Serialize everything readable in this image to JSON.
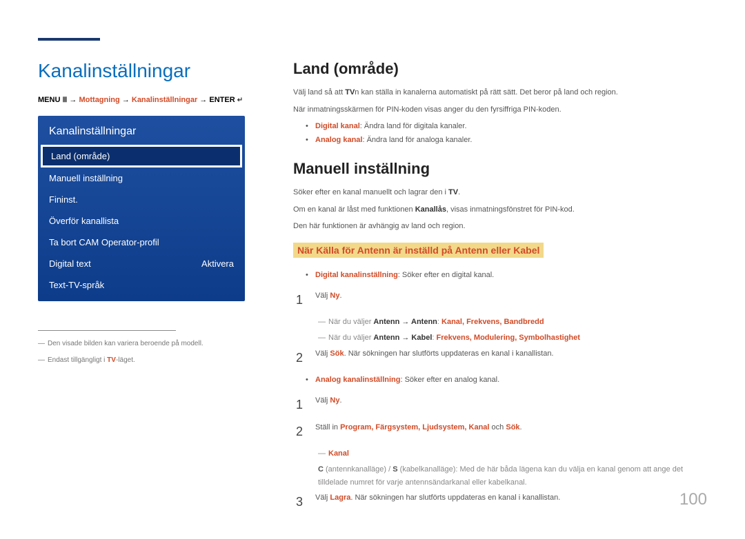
{
  "title": "Kanalinställningar",
  "breadcrumb": {
    "menu": "MENU",
    "arrow": "→",
    "p1": "Mottagning",
    "p2": "Kanalinställningar",
    "enter": "ENTER"
  },
  "menu": {
    "title": "Kanalinställningar",
    "items": [
      {
        "label": "Land (område)",
        "value": "",
        "selected": true
      },
      {
        "label": "Manuell inställning",
        "value": ""
      },
      {
        "label": "Fininst.",
        "value": ""
      },
      {
        "label": "Överför kanallista",
        "value": ""
      },
      {
        "label": "Ta bort CAM Operator-profil",
        "value": ""
      },
      {
        "label": "Digital text",
        "value": "Aktivera"
      },
      {
        "label": "Text-TV-språk",
        "value": ""
      }
    ]
  },
  "footnotes": [
    {
      "pre": "―",
      "text": "Den visade bilden kan variera beroende på modell."
    },
    {
      "pre": "―",
      "text_before": "Endast tillgängligt i ",
      "red": "TV",
      "text_after": "-läget."
    }
  ],
  "land": {
    "head": "Land (område)",
    "p1a": "Välj land så att ",
    "p1b": "TV",
    "p1c": "n kan ställa in kanalerna automatiskt på rätt sätt. Det beror på land och region.",
    "p2": "När inmatningsskärmen för PIN-koden visas anger du den fyrsiffriga PIN-koden.",
    "b1_red": "Digital kanal",
    "b1": ": Ändra land för digitala kanaler.",
    "b2_red": "Analog kanal",
    "b2": ": Ändra land för analoga kanaler."
  },
  "manuell": {
    "head": "Manuell inställning",
    "p1a": "Söker efter en kanal manuellt och lagrar den i ",
    "p1b": "TV",
    "p1c": ".",
    "p2a": "Om en kanal är låst med funktionen ",
    "p2b": "Kanallås",
    "p2c": ", visas inmatningsfönstret för PIN-kod.",
    "p3": "Den här funktionen är avhängig av land och region.",
    "highlight": "När Källa för Antenn är inställd på Antenn eller Kabel",
    "dig_red": "Digital kanalinställning",
    "dig": ": Söker efter en digital kanal.",
    "dig_step1_pre": "Välj ",
    "dig_step1_red": "Ny",
    "dig_step1_post": ".",
    "dig_sub1_pre": "När du väljer ",
    "dig_sub1_b": "Antenn → Antenn",
    "dig_sub1_mid": ": ",
    "dig_sub1_r": "Kanal, Frekvens, Bandbredd",
    "dig_sub2_pre": "När du väljer ",
    "dig_sub2_b": "Antenn → Kabel",
    "dig_sub2_mid": ": ",
    "dig_sub2_r": "Frekvens, Modulering, Symbolhastighet",
    "dig_step2_pre": "Välj ",
    "dig_step2_red": "Sök",
    "dig_step2_post": ". När sökningen har slutförts uppdateras en kanal i kanallistan.",
    "ana_red": "Analog kanalinställning",
    "ana": ": Söker efter en analog kanal.",
    "ana_step1_pre": "Välj ",
    "ana_step1_red": "Ny",
    "ana_step1_post": ".",
    "ana_step2_pre": "Ställ in ",
    "ana_step2_r": "Program, Färgsystem, Ljudsystem, Kanal",
    "ana_step2_mid": " och ",
    "ana_step2_r2": "Sök",
    "ana_step2_post": ".",
    "ana_sub_r": "Kanal",
    "ana_sub_p": "C (antennkanalläge) / S (kabelkanalläge): Med de här båda lägena kan du välja en kanal genom att ange det tilldelade numret för varje antennsändarkanal eller kabelkanal.",
    "ana_sub_b1": "C",
    "ana_sub_t1": " (antennkanalläge) / ",
    "ana_sub_b2": "S",
    "ana_step3_pre": "Välj ",
    "ana_step3_red": "Lagra",
    "ana_step3_post": ". När sökningen har slutförts uppdateras en kanal i kanallistan."
  },
  "pagenum": "100"
}
